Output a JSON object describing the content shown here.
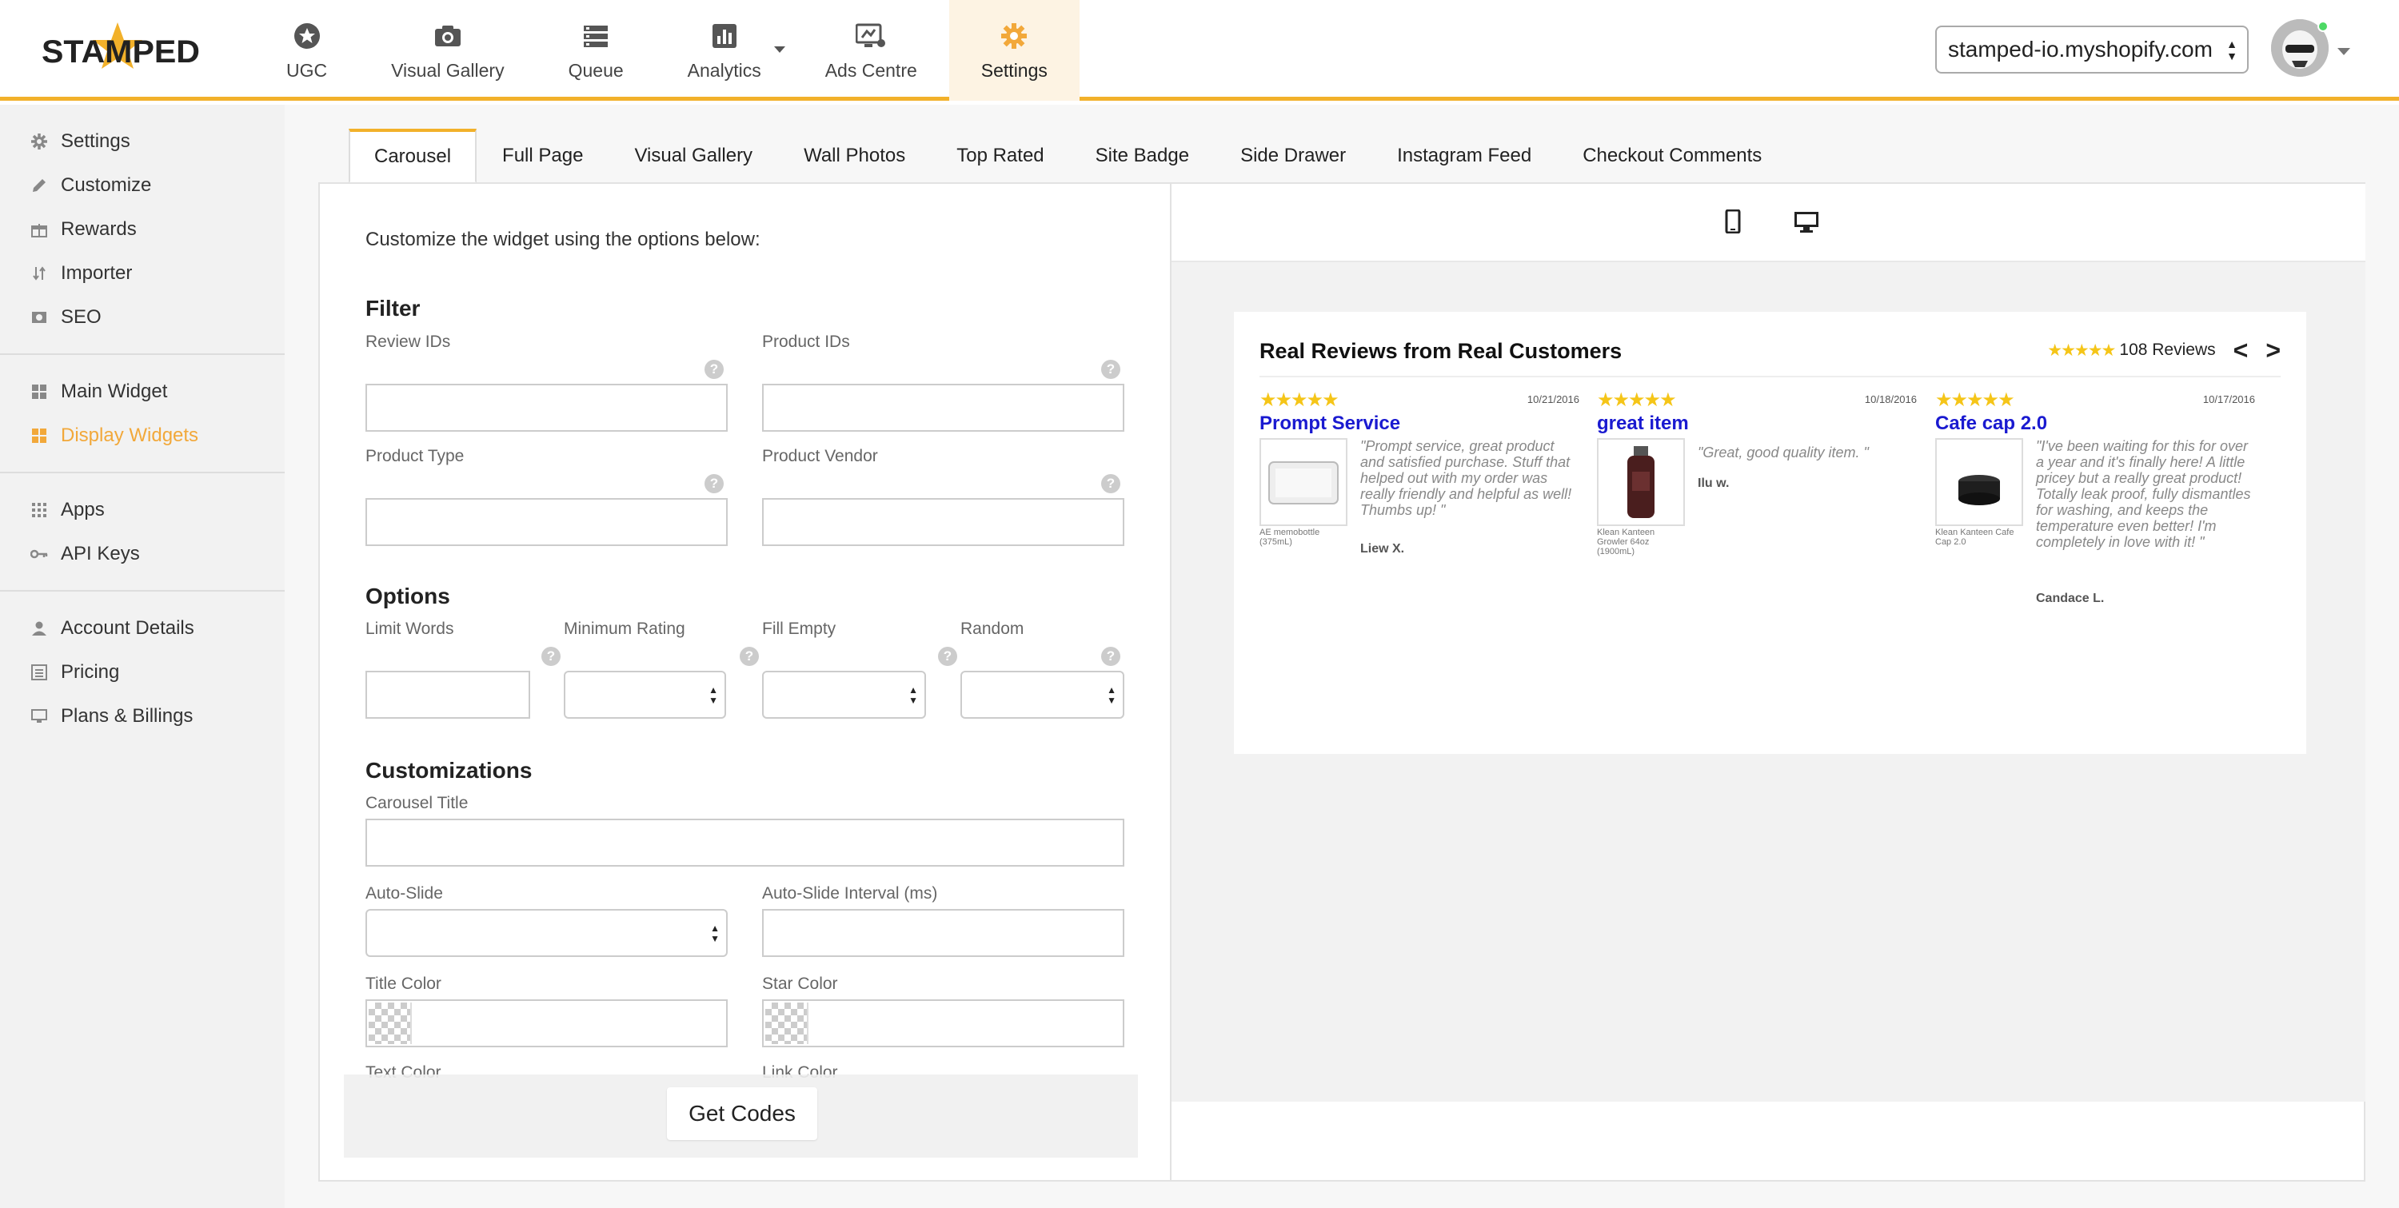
{
  "brand": {
    "logo_text": "STAMPED",
    "accent": "#f2b12a"
  },
  "topnav": [
    {
      "label": "UGC",
      "icon": "star-icon"
    },
    {
      "label": "Visual Gallery",
      "icon": "camera-icon"
    },
    {
      "label": "Queue",
      "icon": "queue-icon"
    },
    {
      "label": "Analytics",
      "icon": "bar-chart-icon"
    },
    {
      "label": "Ads Centre",
      "icon": "ads-icon"
    },
    {
      "label": "Settings",
      "icon": "gear-icon"
    }
  ],
  "shop_select": {
    "value": "stamped-io.myshopify.com"
  },
  "sidebar": {
    "group1": [
      {
        "label": "Settings",
        "icon": "gear-icon"
      },
      {
        "label": "Customize",
        "icon": "pencil-icon"
      },
      {
        "label": "Rewards",
        "icon": "gift-icon"
      },
      {
        "label": "Importer",
        "icon": "sort-icon"
      },
      {
        "label": "SEO",
        "icon": "image-icon"
      }
    ],
    "group2": [
      {
        "label": "Main Widget",
        "icon": "grid-icon"
      },
      {
        "label": "Display Widgets",
        "icon": "grid-icon"
      }
    ],
    "group3": [
      {
        "label": "Apps",
        "icon": "apps-icon"
      },
      {
        "label": "API Keys",
        "icon": "key-icon"
      }
    ],
    "group4": [
      {
        "label": "Account Details",
        "icon": "user-icon"
      },
      {
        "label": "Pricing",
        "icon": "list-icon"
      },
      {
        "label": "Plans & Billings",
        "icon": "monitor-icon"
      }
    ]
  },
  "tabs": [
    "Carousel",
    "Full Page",
    "Visual Gallery",
    "Wall Photos",
    "Top Rated",
    "Site Badge",
    "Side Drawer",
    "Instagram Feed",
    "Checkout Comments"
  ],
  "form": {
    "intro": "Customize the widget using the options below:",
    "filter_heading": "Filter",
    "review_ids": "Review IDs",
    "product_ids": "Product IDs",
    "product_type": "Product Type",
    "product_vendor": "Product Vendor",
    "options_heading": "Options",
    "limit_words": "Limit Words",
    "minimum_rating": "Minimum Rating",
    "fill_empty": "Fill Empty",
    "random": "Random",
    "custom_heading": "Customizations",
    "carousel_title": "Carousel Title",
    "auto_slide": "Auto-Slide",
    "auto_slide_interval": "Auto-Slide Interval (ms)",
    "title_color": "Title Color",
    "star_color": "Star Color",
    "text_color": "Text Color",
    "link_color": "Link Color",
    "help_glyph": "?",
    "get_codes": "Get Codes"
  },
  "preview": {
    "title": "Real Reviews from Real Customers",
    "stars": "★★★★★",
    "count": "108 Reviews",
    "prev": "<",
    "next": ">",
    "reviews": [
      {
        "stars": "★★★★★",
        "date": "10/21/2016",
        "title": "Prompt Service",
        "product": "AE memobottle (375mL)",
        "text": "\"Prompt service, great product and satisfied purchase. Stuff that helped out with my order was really friendly and helpful as well! Thumbs up! \"",
        "author": "Liew X."
      },
      {
        "stars": "★★★★★",
        "date": "10/18/2016",
        "title": "great item",
        "product": "Klean Kanteen Growler 64oz (1900mL)",
        "text": "\"Great, good quality item. \"",
        "author": "Ilu w."
      },
      {
        "stars": "★★★★★",
        "date": "10/17/2016",
        "title": "Cafe cap 2.0",
        "product": "Klean Kanteen Cafe Cap 2.0",
        "text": "\"I've been waiting for this for over a year and it's finally here! A little pricey but a really great product! Totally leak proof, fully dismantles for washing, and keeps the temperature even better! I'm completely in love with it! \"",
        "author": "Candace L."
      }
    ]
  }
}
